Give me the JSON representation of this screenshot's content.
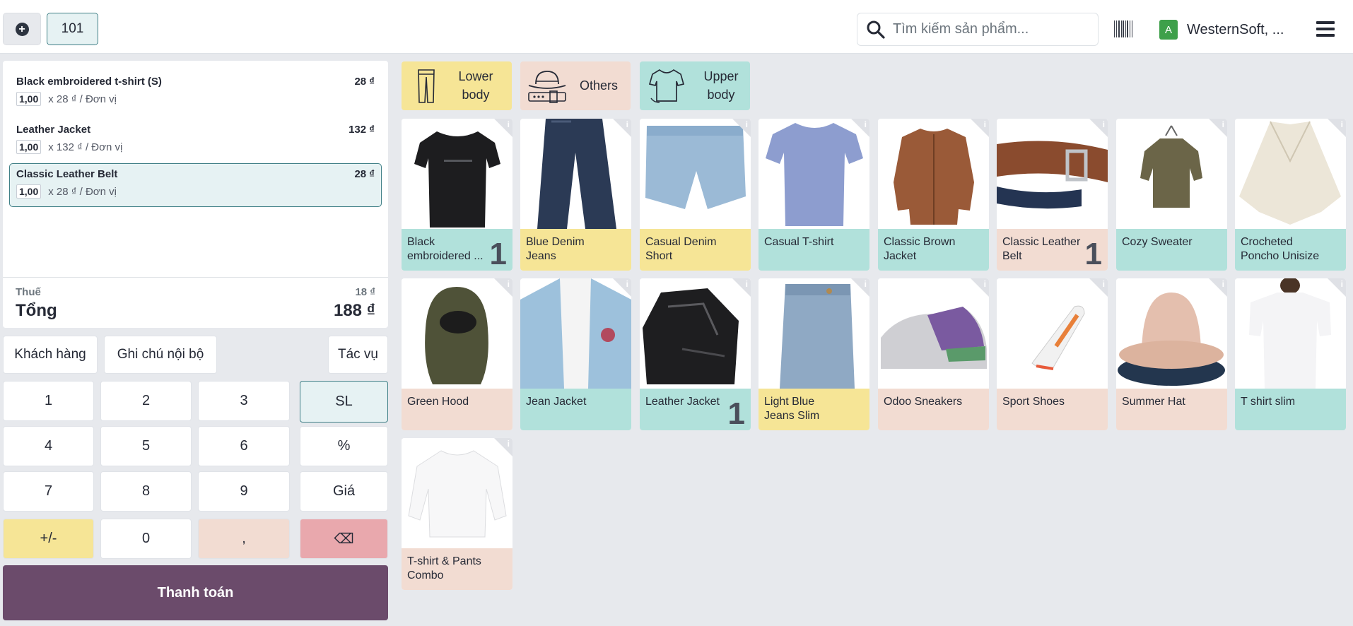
{
  "topbar": {
    "order_number": "101",
    "search_placeholder": "Tìm kiếm sản phẩm...",
    "company_initial": "A",
    "company_name": "WesternSoft, ..."
  },
  "order": {
    "lines": [
      {
        "name": "Black embroidered t-shirt (S)",
        "price": "28 ₫",
        "qty": "1,00",
        "unit": "x 28 ₫ / Đơn vị"
      },
      {
        "name": "Leather Jacket",
        "price": "132 ₫",
        "qty": "1,00",
        "unit": "x 132 ₫ / Đơn vị"
      },
      {
        "name": "Classic Leather Belt",
        "price": "28 ₫",
        "qty": "1,00",
        "unit": "x 28 ₫ / Đơn vị"
      }
    ],
    "tax_label": "Thuế",
    "tax_value": "18 ₫",
    "total_label": "Tổng",
    "total_value": "188 ₫"
  },
  "actions": {
    "customer": "Khách hàng",
    "internal_note": "Ghi chú nội bộ",
    "actions": "Tác vụ"
  },
  "numpad": {
    "k1": "1",
    "k2": "2",
    "k3": "3",
    "qty": "SL",
    "k4": "4",
    "k5": "5",
    "k6": "6",
    "discount": "%",
    "k7": "7",
    "k8": "8",
    "k9": "9",
    "price": "Giá",
    "plusminus": "+/-",
    "k0": "0",
    "comma": ",",
    "backspace": "⌫"
  },
  "pay_label": "Thanh toán",
  "categories": [
    {
      "line1": "Lower",
      "line2": "body",
      "icon": "trousers-icon",
      "color": "#f6e596"
    },
    {
      "line1": "Others",
      "line2": "",
      "icon": "hat-belt-icon",
      "color": "#f2dcd2"
    },
    {
      "line1": "Upper",
      "line2": "body",
      "icon": "tshirt-icon",
      "color": "#b1e1db"
    }
  ],
  "products": [
    {
      "name": "Black embroidered ...",
      "count": "1",
      "color": "teal"
    },
    {
      "name": "Blue Denim Jeans",
      "count": "",
      "color": "yellow"
    },
    {
      "name": "Casual Denim Short",
      "count": "",
      "color": "yellow"
    },
    {
      "name": "Casual T-shirt",
      "count": "",
      "color": "teal"
    },
    {
      "name": "Classic Brown Jacket",
      "count": "",
      "color": "teal"
    },
    {
      "name": "Classic Leather Belt",
      "count": "1",
      "color": "peach"
    },
    {
      "name": "Cozy Sweater",
      "count": "",
      "color": "teal"
    },
    {
      "name": "Crocheted Poncho Unisize",
      "count": "",
      "color": "teal"
    },
    {
      "name": "Green Hood",
      "count": "",
      "color": "peach"
    },
    {
      "name": "Jean Jacket",
      "count": "",
      "color": "teal"
    },
    {
      "name": "Leather Jacket",
      "count": "1",
      "color": "teal"
    },
    {
      "name": "Light Blue Jeans Slim",
      "count": "",
      "color": "yellow"
    },
    {
      "name": "Odoo Sneakers",
      "count": "",
      "color": "peach"
    },
    {
      "name": "Sport Shoes",
      "count": "",
      "color": "peach"
    },
    {
      "name": "Summer Hat",
      "count": "",
      "color": "peach"
    },
    {
      "name": "T shirt slim",
      "count": "",
      "color": "teal"
    },
    {
      "name": "T-shirt & Pants Combo",
      "count": "",
      "color": "peach"
    }
  ],
  "info_glyph": "i"
}
